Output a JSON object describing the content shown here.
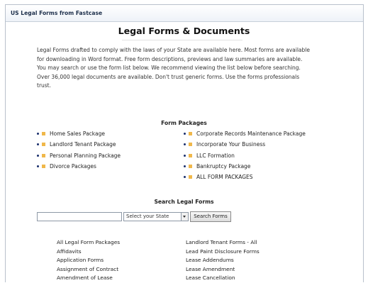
{
  "window": {
    "title": "US Legal Forms from Fastcase"
  },
  "page": {
    "heading": "Legal Forms & Documents",
    "intro_lines": [
      "Legal Forms drafted to comply with the laws of your State are available here. Most forms are available",
      "for downloading in Word format. Free form descriptions, previews and law summaries are available.",
      "You may search or use the form list below. We recommend viewing the list below before searching.",
      "Over 36,000 legal documents are available. Don't trust generic forms. Use the forms professionals",
      "trust."
    ]
  },
  "packages": {
    "title": "Form Packages",
    "left": [
      "Home Sales Package",
      "Landlord Tenant Package",
      "Personal Planning Package",
      "Divorce Packages"
    ],
    "right": [
      "Corporate Records Maintenance Package",
      "Incorporate Your Business",
      "LLC Formation",
      "Bankruptcy Package",
      "ALL FORM PACKAGES"
    ]
  },
  "search": {
    "title": "Search Legal Forms",
    "input_value": "",
    "state_select": "Select your State",
    "button_label": "Search Forms"
  },
  "forms": {
    "left": [
      "All Legal Form Packages",
      "Affidavits",
      "Application Forms",
      "Assignment of Contract",
      "Amendment of Lease"
    ],
    "right": [
      "Landlord Tenant Forms - All",
      "Lead Paint Disclosure Forms",
      "Lease Addendums",
      "Lease Amendment",
      "Lease Cancellation"
    ]
  },
  "colors": {
    "bullet": "#1a2f6b",
    "accent_square": "#f0b84a",
    "title_text": "#1c2e4a"
  },
  "icons": {
    "bullet_dot": "bullet-dot-icon",
    "package_marker": "square-marker-icon",
    "select_arrow": "chevron-down-icon"
  }
}
